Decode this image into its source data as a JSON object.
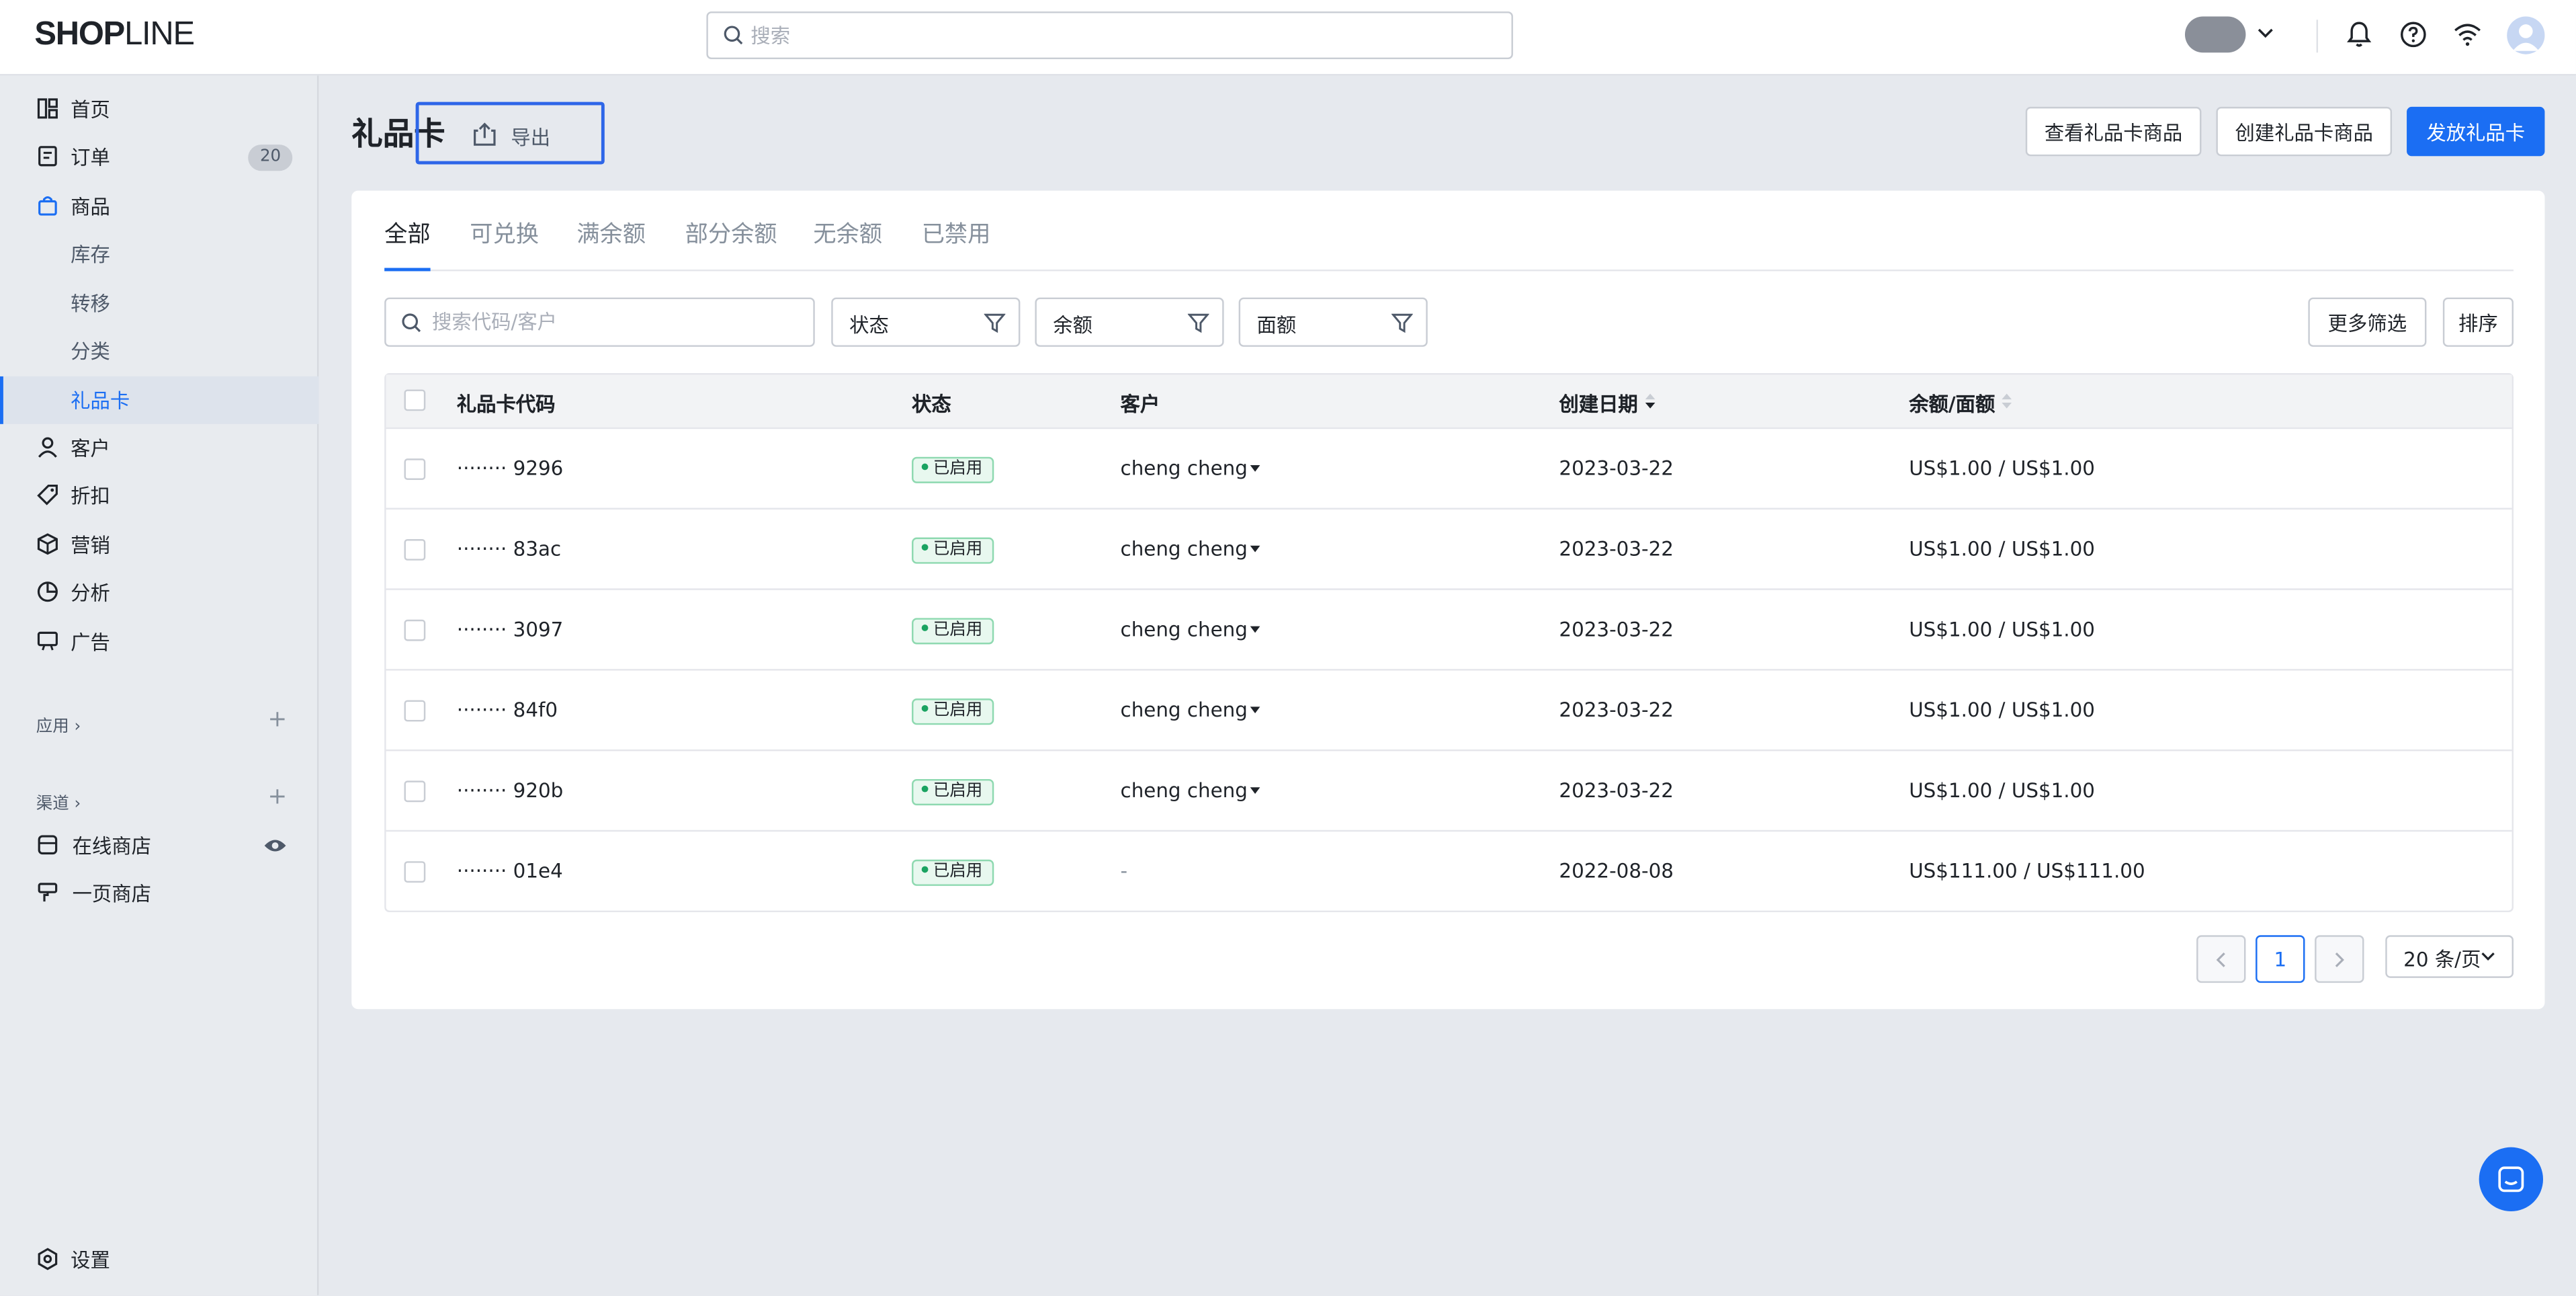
{
  "topbar": {
    "logo_bold": "SHOP",
    "logo_light": "LINE",
    "search_placeholder": "搜索"
  },
  "sidebar": {
    "items": [
      {
        "label": "首页",
        "icon": "dashboard-icon"
      },
      {
        "label": "订单",
        "icon": "order-icon",
        "badge": "20"
      },
      {
        "label": "商品",
        "icon": "bag-icon"
      },
      {
        "label": "库存"
      },
      {
        "label": "转移"
      },
      {
        "label": "分类"
      },
      {
        "label": "礼品卡"
      },
      {
        "label": "客户",
        "icon": "user-icon"
      },
      {
        "label": "折扣",
        "icon": "tag-icon"
      },
      {
        "label": "营销",
        "icon": "cube-icon"
      },
      {
        "label": "分析",
        "icon": "pie-icon"
      },
      {
        "label": "广告",
        "icon": "ad-icon"
      }
    ],
    "apps_label": "应用 ›",
    "channels_label": "渠道 ›",
    "channels": [
      {
        "label": "在线商店",
        "icon": "store-icon"
      },
      {
        "label": "一页商店",
        "icon": "brush-icon"
      }
    ],
    "settings_label": "设置"
  },
  "header": {
    "title": "礼品卡",
    "export_label": "导出",
    "view_products_label": "查看礼品卡商品",
    "create_product_label": "创建礼品卡商品",
    "issue_label": "发放礼品卡"
  },
  "tabs": [
    "全部",
    "可兑换",
    "满余额",
    "部分余额",
    "无余额",
    "已禁用"
  ],
  "filters": {
    "search_placeholder": "搜索代码/客户",
    "status_label": "状态",
    "balance_label": "余额",
    "face_value_label": "面额",
    "more_filters_label": "更多筛选",
    "sort_label": "排序"
  },
  "table": {
    "columns": [
      "礼品卡代码",
      "状态",
      "客户",
      "创建日期",
      "余额/面额"
    ],
    "rows": [
      {
        "code": "········ 9296",
        "status": "已启用",
        "customer": "cheng cheng",
        "date": "2023-03-22",
        "amount": "US$1.00 / US$1.00"
      },
      {
        "code": "········ 83ac",
        "status": "已启用",
        "customer": "cheng cheng",
        "date": "2023-03-22",
        "amount": "US$1.00 / US$1.00"
      },
      {
        "code": "········ 3097",
        "status": "已启用",
        "customer": "cheng cheng",
        "date": "2023-03-22",
        "amount": "US$1.00 / US$1.00"
      },
      {
        "code": "········ 84f0",
        "status": "已启用",
        "customer": "cheng cheng",
        "date": "2023-03-22",
        "amount": "US$1.00 / US$1.00"
      },
      {
        "code": "········ 920b",
        "status": "已启用",
        "customer": "cheng cheng",
        "date": "2023-03-22",
        "amount": "US$1.00 / US$1.00"
      },
      {
        "code": "········ 01e4",
        "status": "已启用",
        "customer": "-",
        "date": "2022-08-08",
        "amount": "US$111.00 / US$111.00"
      }
    ]
  },
  "pagination": {
    "current_page": "1",
    "page_size_label": "20 条/页"
  },
  "colors": {
    "accent": "#1b6ef3",
    "status_green": "#1aa361",
    "highlight_border": "#2e66e8"
  }
}
